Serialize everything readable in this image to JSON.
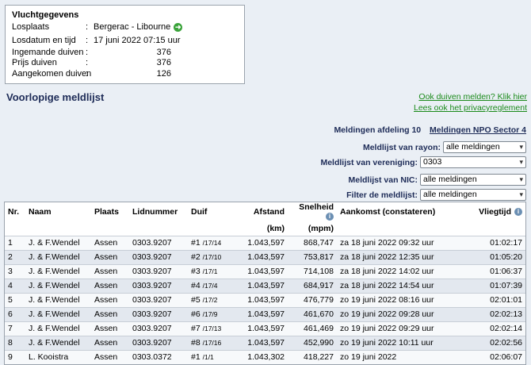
{
  "flight": {
    "title": "Vluchtgegevens",
    "rows": [
      {
        "label": "Losplaats",
        "value": "Bergerac - Libourne"
      },
      {
        "label": "Losdatum en tijd",
        "value": "17 juni 2022 07:15 uur"
      },
      {
        "label": "Ingemande duiven",
        "value": "376"
      },
      {
        "label": "Prijs duiven",
        "value": "376"
      },
      {
        "label": "Aangekomen duiven",
        "value": "126"
      }
    ],
    "colon": ":"
  },
  "heading": "Voorlopige meldlijst",
  "links": {
    "report": "Ook duiven melden? Klik hier",
    "privacy": "Lees ook het privacyreglement"
  },
  "meldingen": {
    "afdeling": "Meldingen afdeling 10",
    "npo": "Meldingen NPO Sector 4"
  },
  "filters": [
    {
      "label": "Meldlijst van rayon:",
      "value": "alle meldingen"
    },
    {
      "label": "Meldlijst van vereniging:",
      "value": "0303"
    },
    {
      "label": "Meldlijst van NIC:",
      "value": "alle meldingen"
    },
    {
      "label": "Filter de meldlijst:",
      "value": "alle meldingen"
    }
  ],
  "table": {
    "headers": {
      "nr": "Nr.",
      "naam": "Naam",
      "plaats": "Plaats",
      "lidnummer": "Lidnummer",
      "duif": "Duif",
      "afstand": "Afstand",
      "afstand_unit": "(km)",
      "snelheid": "Snelheid",
      "snelheid_unit": "(mpm)",
      "aankomst": "Aankomst (constateren)",
      "vliegtijd": "Vliegtijd"
    },
    "rows": [
      {
        "nr": "1",
        "naam": "J. & F.Wendel",
        "plaats": "Assen",
        "lid": "0303.9207",
        "duif": "#1",
        "ring": "/17/14",
        "afstand": "1.043,597",
        "snelheid": "868,747",
        "aankomst": "za 18 juni 2022 09:32 uur",
        "vliegtijd": "01:02:17"
      },
      {
        "nr": "2",
        "naam": "J. & F.Wendel",
        "plaats": "Assen",
        "lid": "0303.9207",
        "duif": "#2",
        "ring": "/17/10",
        "afstand": "1.043,597",
        "snelheid": "753,817",
        "aankomst": "za 18 juni 2022 12:35 uur",
        "vliegtijd": "01:05:20"
      },
      {
        "nr": "3",
        "naam": "J. & F.Wendel",
        "plaats": "Assen",
        "lid": "0303.9207",
        "duif": "#3",
        "ring": "/17/1",
        "afstand": "1.043,597",
        "snelheid": "714,108",
        "aankomst": "za 18 juni 2022 14:02 uur",
        "vliegtijd": "01:06:37"
      },
      {
        "nr": "4",
        "naam": "J. & F.Wendel",
        "plaats": "Assen",
        "lid": "0303.9207",
        "duif": "#4",
        "ring": "/17/4",
        "afstand": "1.043,597",
        "snelheid": "684,917",
        "aankomst": "za 18 juni 2022 14:54 uur",
        "vliegtijd": "01:07:39"
      },
      {
        "nr": "5",
        "naam": "J. & F.Wendel",
        "plaats": "Assen",
        "lid": "0303.9207",
        "duif": "#5",
        "ring": "/17/2",
        "afstand": "1.043,597",
        "snelheid": "476,779",
        "aankomst": "zo 19 juni 2022 08:16 uur",
        "vliegtijd": "02:01:01"
      },
      {
        "nr": "6",
        "naam": "J. & F.Wendel",
        "plaats": "Assen",
        "lid": "0303.9207",
        "duif": "#6",
        "ring": "/17/9",
        "afstand": "1.043,597",
        "snelheid": "461,670",
        "aankomst": "zo 19 juni 2022 09:28 uur",
        "vliegtijd": "02:02:13"
      },
      {
        "nr": "7",
        "naam": "J. & F.Wendel",
        "plaats": "Assen",
        "lid": "0303.9207",
        "duif": "#7",
        "ring": "/17/13",
        "afstand": "1.043,597",
        "snelheid": "461,469",
        "aankomst": "zo 19 juni 2022 09:29 uur",
        "vliegtijd": "02:02:14"
      },
      {
        "nr": "8",
        "naam": "J. & F.Wendel",
        "plaats": "Assen",
        "lid": "0303.9207",
        "duif": "#8",
        "ring": "/17/16",
        "afstand": "1.043,597",
        "snelheid": "452,990",
        "aankomst": "zo 19 juni 2022 10:11 uur",
        "vliegtijd": "02:02:56"
      },
      {
        "nr": "9",
        "naam": "L. Kooistra",
        "plaats": "Assen",
        "lid": "0303.0372",
        "duif": "#1",
        "ring": "/1/1",
        "afstand": "1.043,302",
        "snelheid": "418,227",
        "aankomst": "zo 19 juni 2022 ",
        "vliegtijd": "02:06:07"
      }
    ]
  }
}
